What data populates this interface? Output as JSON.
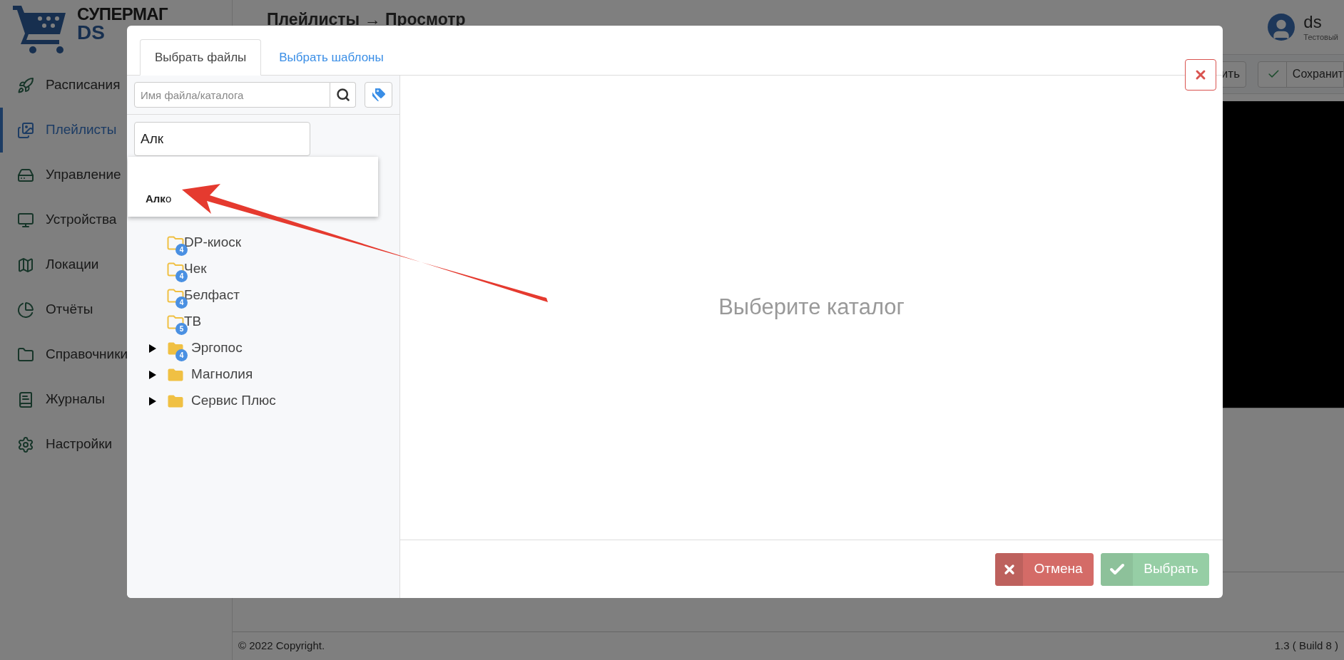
{
  "logo": {
    "title": "СУПЕРМАГ",
    "subtitle": "DS"
  },
  "breadcrumb": "Плейлисты → Просмотр",
  "user": {
    "name": "ds",
    "role": "Тестовый"
  },
  "sidebar": {
    "items": [
      {
        "label": "Расписания",
        "selected": false
      },
      {
        "label": "Плейлисты",
        "selected": true
      },
      {
        "label": "Управление",
        "selected": false
      },
      {
        "label": "Устройства",
        "selected": false
      },
      {
        "label": "Локации",
        "selected": false
      },
      {
        "label": "Отчёты",
        "selected": false
      },
      {
        "label": "Справочники",
        "selected": false
      },
      {
        "label": "Журналы",
        "selected": false
      },
      {
        "label": "Настройки",
        "selected": false
      }
    ]
  },
  "toolbar": {
    "buttons": [
      "ить",
      "Сохранит"
    ]
  },
  "footer": {
    "copyright": "© 2022 Copyright.",
    "version": "1.3 ( Build 8 )"
  },
  "dialog": {
    "tabs": [
      {
        "label": "Выбрать файлы",
        "selected": true
      },
      {
        "label": "Выбрать шаблоны",
        "selected": false
      }
    ],
    "search": {
      "placeholder": "Имя файла/каталога"
    },
    "tag_filter": {
      "value": "Алк"
    },
    "suggestions": [
      "**Алк**о"
    ],
    "tree": [
      {
        "kind": "leaf",
        "label": "DP-киоск",
        "badge": "4"
      },
      {
        "kind": "leaf",
        "label": "Чек",
        "badge": "4"
      },
      {
        "kind": "leaf",
        "label": "Белфаст",
        "badge": "4"
      },
      {
        "kind": "leaf",
        "label": "ТВ",
        "badge": "5"
      },
      {
        "kind": "branch",
        "label": "Эргопос",
        "badge": "4",
        "expanded": false
      },
      {
        "kind": "branch",
        "label": "Магнолия",
        "expanded": false
      },
      {
        "kind": "branch",
        "label": "Сервис Плюс",
        "expanded": false
      }
    ],
    "empty_message": "Выберите каталог",
    "buttons": {
      "cancel": "Отмена",
      "select": "Выбрать"
    }
  }
}
